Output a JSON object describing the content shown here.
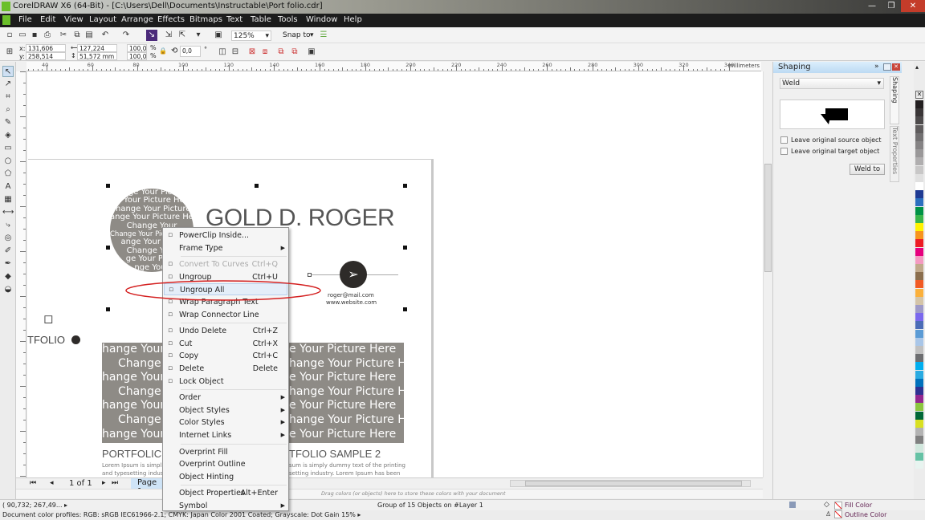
{
  "title": "CorelDRAW X6 (64-Bit) - [C:\\Users\\Dell\\Documents\\Instructable\\Port folio.cdr]",
  "menubar": [
    "File",
    "Edit",
    "View",
    "Layout",
    "Arrange",
    "Effects",
    "Bitmaps",
    "Text",
    "Table",
    "Tools",
    "Window",
    "Help"
  ],
  "toolbar": {
    "zoom": "125%",
    "snap": "Snap to"
  },
  "propbar": {
    "x": "131,606 mm",
    "y": "258,514 mm",
    "w": "127,224 mm",
    "h": "51,572 mm",
    "sx": "100,0",
    "sy": "100,0",
    "pct": "%",
    "angle": "0,0",
    "deg": "°"
  },
  "ruler": {
    "labels": [
      "40",
      "60",
      "80",
      "100",
      "120",
      "140",
      "160",
      "180",
      "200",
      "220",
      "240",
      "260",
      "280",
      "300",
      "320",
      "340"
    ],
    "unit": "millimeters"
  },
  "canvas": {
    "name": "GOLD D. ROGER",
    "circle_text": "Change Your Picture Here",
    "email": "roger@mail.com",
    "website": "www.website.com",
    "folio": "TFOLIO",
    "portfolio1": "PORTFOLIC",
    "portfolio2": "TFOLIO SAMPLE 2",
    "lorem1a": "Lorem Ipsum is simpl",
    "lorem1b": "and typesetting indus",
    "lorem2a": "sum is simply dummy text of the printing",
    "lorem2b": "setting industry. Lorem Ipsum has been",
    "img_left": [
      "hange Your",
      "Change `",
      "hange Your",
      "Change `",
      "hange Your",
      "Change `",
      "hange Your"
    ],
    "img_right": [
      "e Your Picture Here",
      "hange Your Picture Here",
      "e Your Picture Here",
      "hange Your Picture Here",
      "e Your Picture Here",
      "hange Your Picture Here",
      "e Your Picture Here"
    ],
    "circle_lines": [
      "nge Your Pictu",
      "ge Your Picture Here",
      "Change Your Picture H",
      "ange Your Picture Here",
      "Change Your",
      "ange Your Pictu",
      "Change Your",
      "ge Your Pictu",
      "nge Your"
    ]
  },
  "context_menu": [
    {
      "label": "PowerClip Inside...",
      "icon": "powerclip-icon"
    },
    {
      "label": "Frame Type",
      "submenu": true
    },
    {
      "sep": true
    },
    {
      "label": "Convert To Curves",
      "shortcut": "Ctrl+Q",
      "disabled": true,
      "icon": "convert-icon"
    },
    {
      "label": "Ungroup",
      "shortcut": "Ctrl+U",
      "icon": "ungroup-icon"
    },
    {
      "label": "Ungroup All",
      "highlight": true,
      "icon": "ungroup-all-icon"
    },
    {
      "label": "Wrap Paragraph Text",
      "icon": "wrap-text-icon"
    },
    {
      "label": "Wrap Connector Line",
      "icon": "wrap-connector-icon"
    },
    {
      "sep": true
    },
    {
      "label": "Undo Delete",
      "shortcut": "Ctrl+Z",
      "icon": "undo-icon"
    },
    {
      "label": "Cut",
      "shortcut": "Ctrl+X",
      "icon": "scissors-icon"
    },
    {
      "label": "Copy",
      "shortcut": "Ctrl+C",
      "icon": "copy-icon"
    },
    {
      "label": "Delete",
      "shortcut": "Delete",
      "icon": "trash-icon"
    },
    {
      "label": "Lock Object",
      "icon": "lock-icon"
    },
    {
      "sep": true
    },
    {
      "label": "Order",
      "submenu": true
    },
    {
      "label": "Object Styles",
      "submenu": true
    },
    {
      "label": "Color Styles",
      "submenu": true
    },
    {
      "label": "Internet Links",
      "submenu": true
    },
    {
      "sep": true
    },
    {
      "label": "Overprint Fill"
    },
    {
      "label": "Overprint Outline"
    },
    {
      "label": "Object Hinting"
    },
    {
      "sep": true
    },
    {
      "label": "Object Properties",
      "shortcut": "Alt+Enter"
    },
    {
      "label": "Symbol",
      "submenu": true
    }
  ],
  "docker": {
    "title": "Shaping",
    "mode": "Weld",
    "leave_source": "Leave original source object",
    "leave_target": "Leave original target object",
    "button": "Weld to",
    "tab1": "Shaping",
    "tab2": "Text Properties"
  },
  "pagenav": {
    "count": "1 of 1",
    "tab": "Page 1"
  },
  "colorwell_hint": "Drag colors (or objects) here to store these colors with your document",
  "status": {
    "coords": "( 90,732; 267,49... ▸",
    "selection": "Group of 15 Objects on #Layer 1",
    "fill": "Fill Color",
    "outline": "Outline Color",
    "profiles": "Document color profiles: RGB: sRGB IEC61966-2.1; CMYK: Japan Color 2001 Coated; Grayscale: Dot Gain 15% ▸"
  },
  "palette": [
    "#231f20",
    "#3a3637",
    "#4d4a4b",
    "#5f5c5d",
    "#727071",
    "#858384",
    "#9a9899",
    "#b0aeaf",
    "#c8c7c7",
    "#e0e0e0",
    "#ffffff",
    "#1f3a93",
    "#2c6fbf",
    "#009245",
    "#39b54a",
    "#fff200",
    "#f7941d",
    "#ed1c24",
    "#e6007e",
    "#f49ac1",
    "#c1a98b",
    "#8b6e4e",
    "#f15a24",
    "#fbb03b",
    "#d4c4a8",
    "#9e9ac8",
    "#7b68ee",
    "#4b6cb7",
    "#5b9bd5",
    "#a9c6e8",
    "#c0c0c0",
    "#6d6e71",
    "#00aeef",
    "#29abe2",
    "#0071bc",
    "#2e3192",
    "#93278f",
    "#8cc63f",
    "#006837",
    "#d9e021",
    "#b3b3b3",
    "#808080",
    "#d1e7dd",
    "#66c2a5",
    "#e8f4f0"
  ],
  "colors": {
    "accent_red": "#d42020",
    "menu_highlight": "#e4eef9",
    "image_gray": "#8e8b86"
  }
}
